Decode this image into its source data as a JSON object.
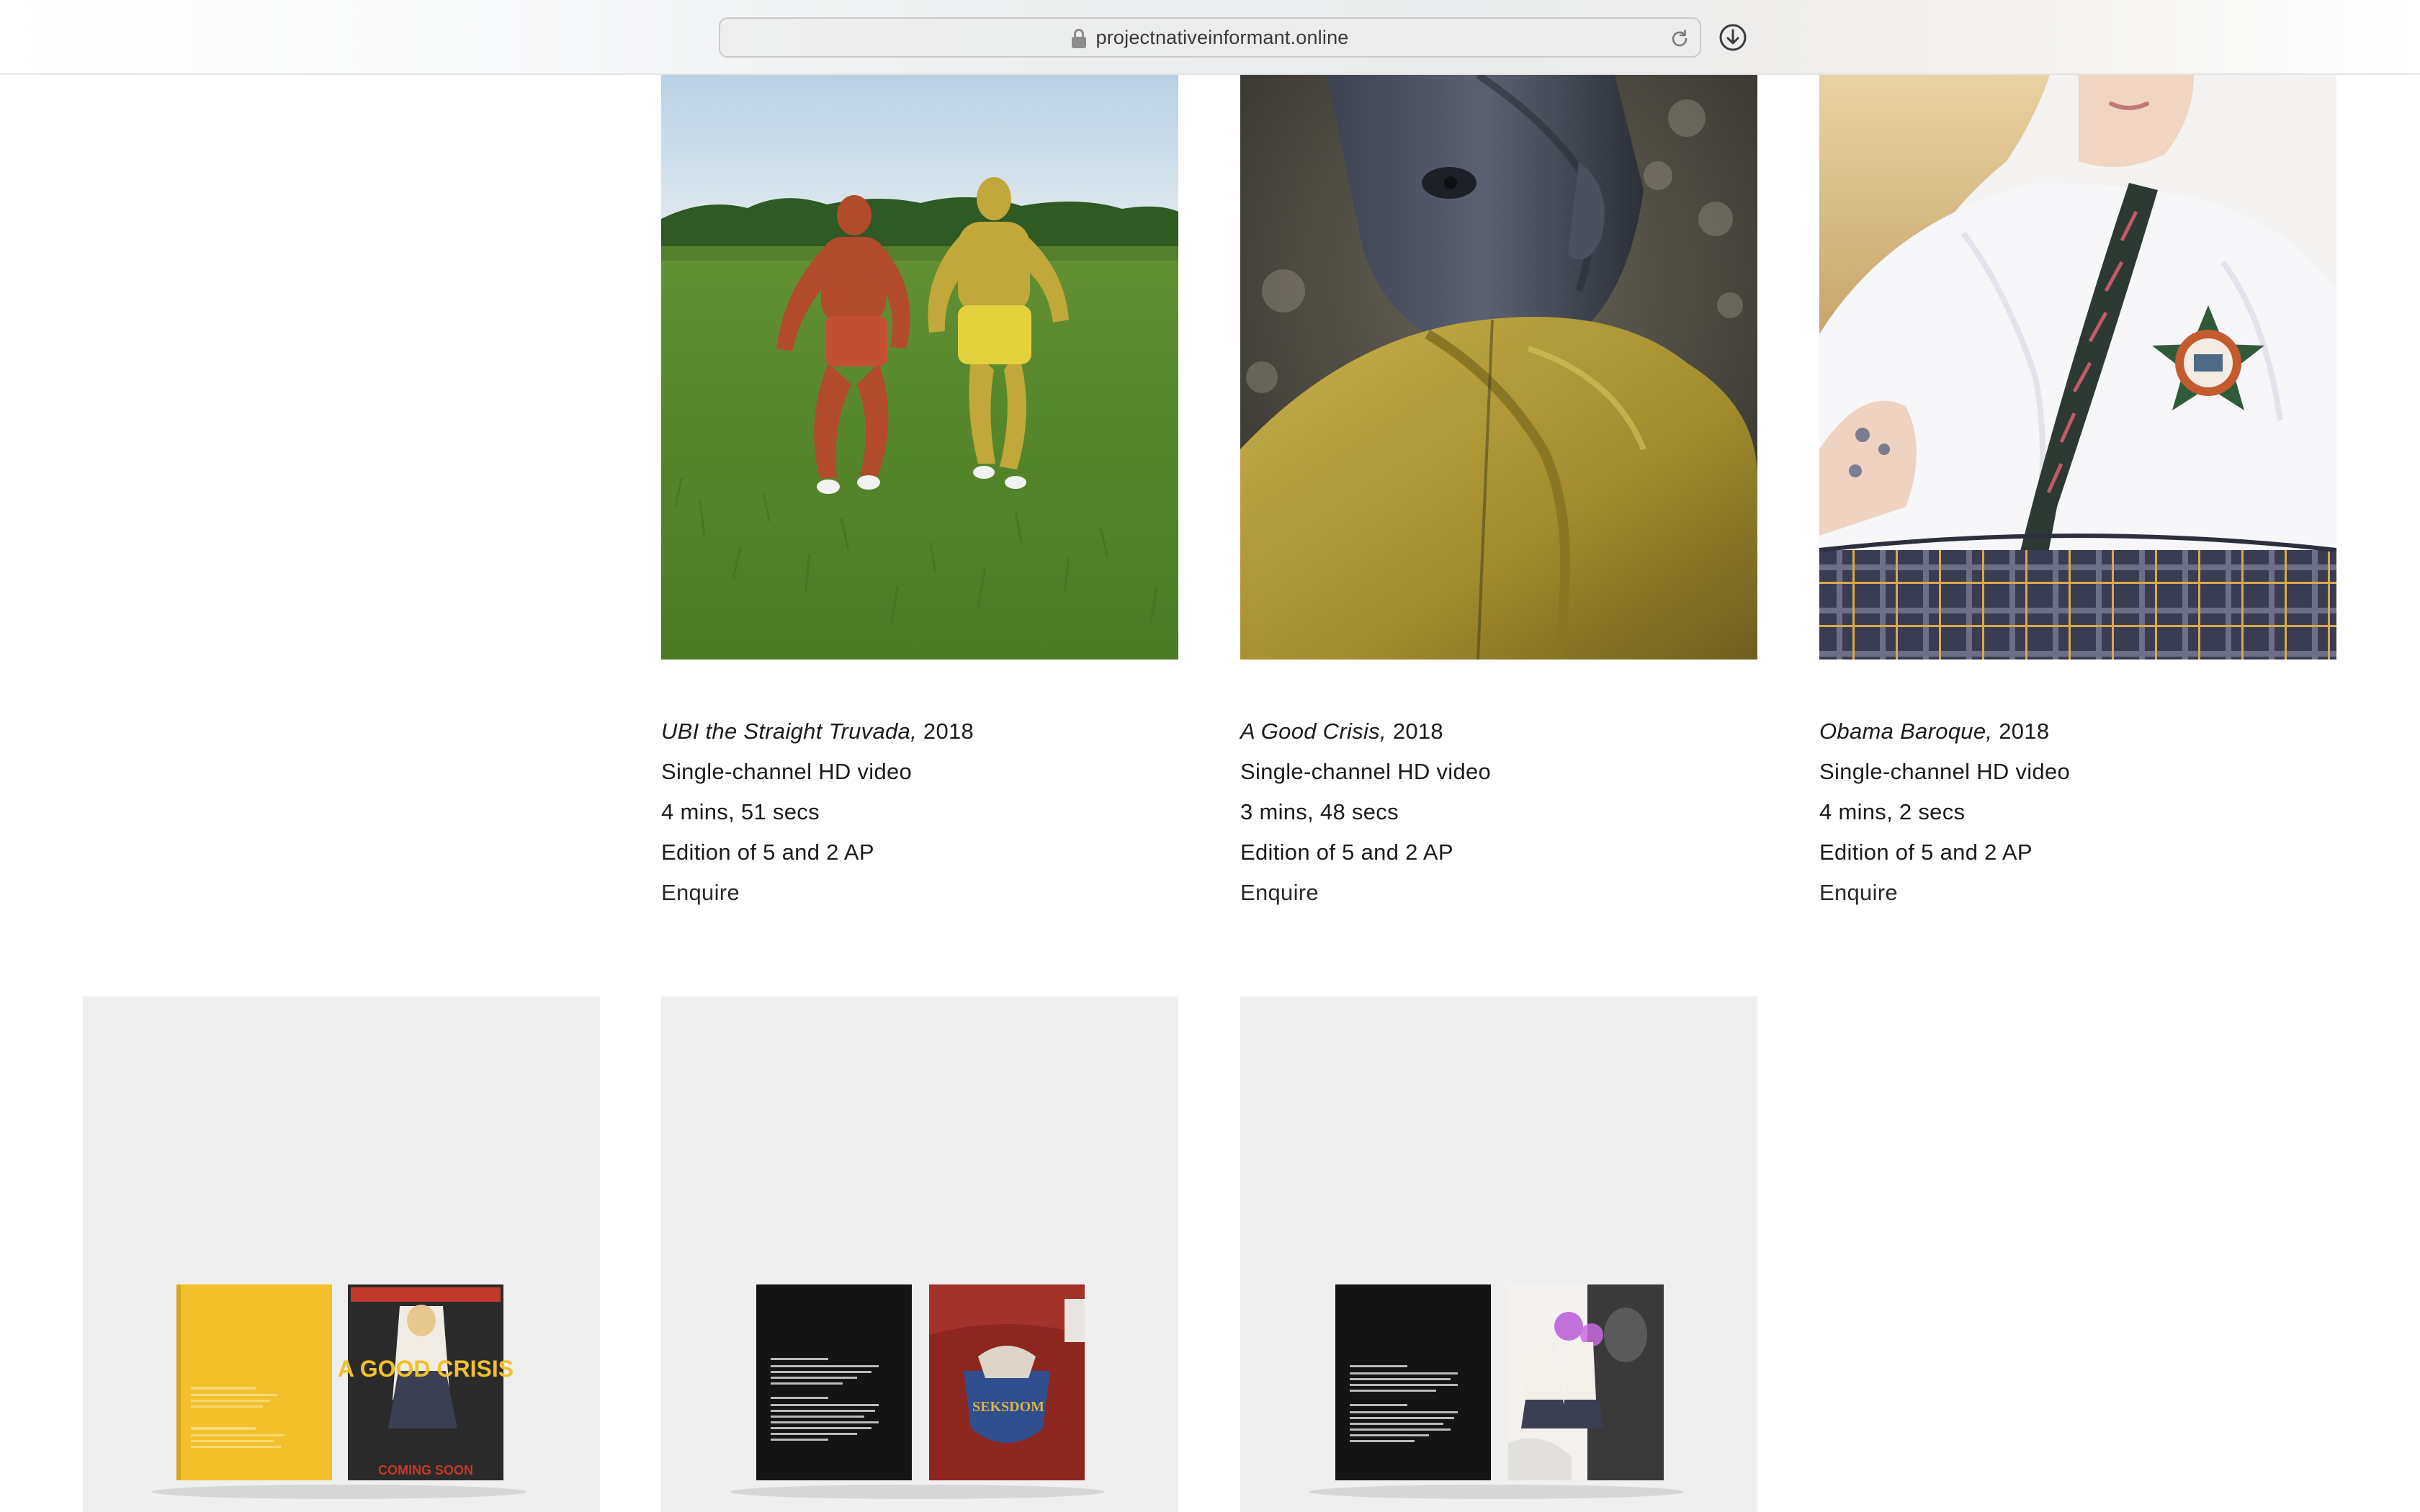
{
  "browser": {
    "url": "projectnativeinformant.online"
  },
  "works": [
    {
      "title": "UBI the Straight Truvada,",
      "year": "2018",
      "medium": "Single-channel HD video",
      "duration": "4 mins, 51 secs",
      "edition": "Edition of 5 and 2 AP",
      "enquire": "Enquire"
    },
    {
      "title": "A Good Crisis,",
      "year": "2018",
      "medium": "Single-channel HD video",
      "duration": "3 mins, 48 secs",
      "edition": "Edition of 5 and 2 AP",
      "enquire": "Enquire"
    },
    {
      "title": "Obama Baroque,",
      "year": "2018",
      "medium": "Single-channel HD video",
      "duration": "4 mins, 2 secs",
      "edition": "Edition of 5 and 2 AP",
      "enquire": "Enquire"
    }
  ],
  "books": [
    {
      "cover_text": "A GOOD CRISIS",
      "bottom_text": "COMING SOON"
    },
    {
      "cover_text": "SEKSDOM"
    },
    {
      "cover_text": ""
    }
  ],
  "colors": {
    "caption_text": "#1b1b1b",
    "card_bg": "#efefef",
    "book_yellow": "#f1c02a",
    "book_black": "#141414"
  }
}
